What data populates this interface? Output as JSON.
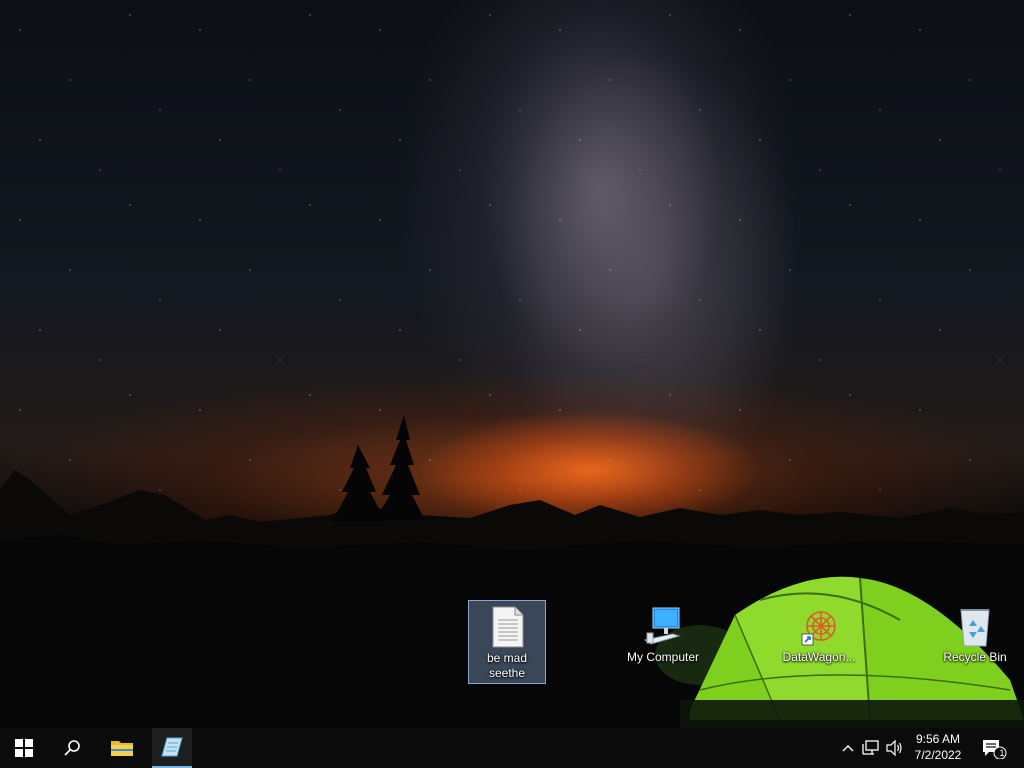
{
  "desktop": {
    "icons": [
      {
        "label": "be mad seethe",
        "type": "text-document",
        "selected": true
      },
      {
        "label": "My Computer",
        "type": "computer",
        "selected": false
      },
      {
        "label": "DataWagon...",
        "type": "shortcut",
        "selected": false
      },
      {
        "label": "Recycle Bin",
        "type": "recycle-bin",
        "selected": false
      }
    ]
  },
  "taskbar": {
    "buttons": [
      {
        "name": "start",
        "icon": "windows-logo-icon"
      },
      {
        "name": "search",
        "icon": "search-icon"
      },
      {
        "name": "file-explorer",
        "icon": "folder-icon"
      },
      {
        "name": "pinned-app",
        "icon": "notepad-icon",
        "active": true
      }
    ],
    "tray": {
      "icons": [
        "chevron-up-icon",
        "network-icon",
        "volume-icon"
      ],
      "time": "9:56 AM",
      "date": "7/2/2022",
      "notification_count": "1"
    }
  }
}
